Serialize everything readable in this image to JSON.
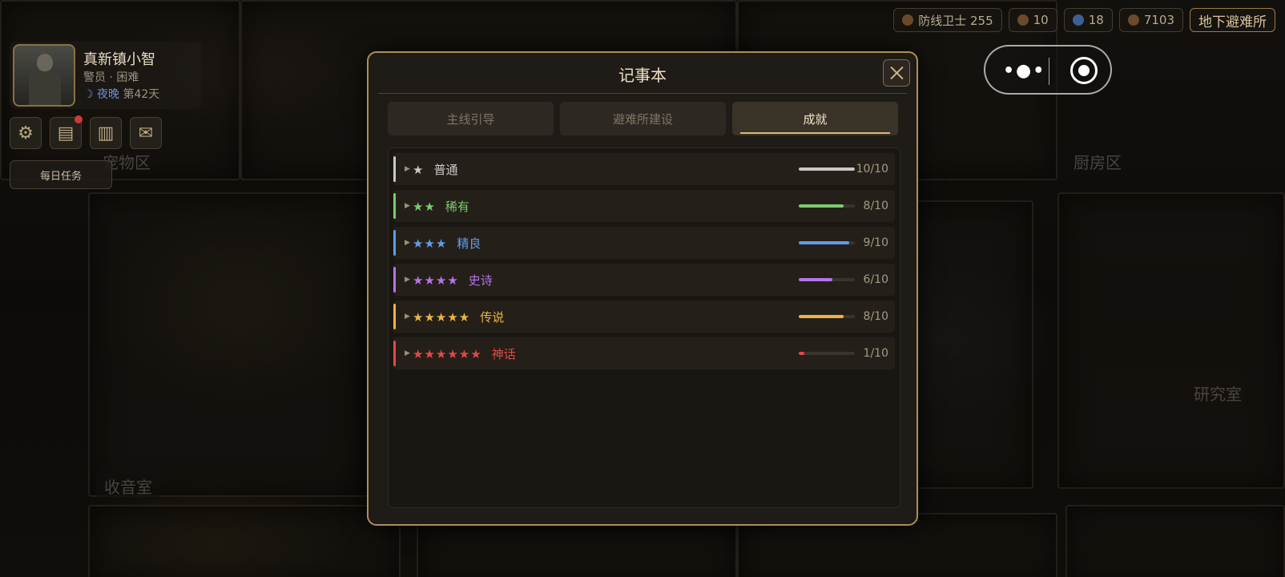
{
  "player": {
    "name": "真新镇小智",
    "rank": "警员 · 困难",
    "time_of_day": "夜晚",
    "day": "第42天"
  },
  "side": {
    "icons": [
      "gear-icon",
      "notebook-icon",
      "book-icon",
      "mail-icon"
    ],
    "daily_task": "每日任务"
  },
  "resources": [
    {
      "label": "防线卫士 255",
      "icon": "shield-icon"
    },
    {
      "label": "10",
      "icon": "coin-icon"
    },
    {
      "label": "18",
      "icon": "gem-icon"
    },
    {
      "label": "7103",
      "icon": "scrap-icon"
    }
  ],
  "location": "地下避难所",
  "rooms": {
    "pet": "宠物区",
    "kitchen": "厨房区",
    "radio": "收音室",
    "research": "研究室"
  },
  "modal": {
    "title": "记事本",
    "tabs": [
      "主线引导",
      "避难所建设",
      "成就"
    ],
    "active_tab": "成就",
    "rows": [
      {
        "stars": "★",
        "name": "普通",
        "progress": 1.0,
        "count": "10/10",
        "color": "#c8c8c8"
      },
      {
        "stars": "★★",
        "name": "稀有",
        "progress": 0.8,
        "count": "8/10",
        "color": "#7ccb6f"
      },
      {
        "stars": "★★★",
        "name": "精良",
        "progress": 0.9,
        "count": "9/10",
        "color": "#5f9de8"
      },
      {
        "stars": "★★★★",
        "name": "史诗",
        "progress": 0.6,
        "count": "6/10",
        "color": "#b574e6"
      },
      {
        "stars": "★★★★★",
        "name": "传说",
        "progress": 0.8,
        "count": "8/10",
        "color": "#f0b341"
      },
      {
        "stars": "★★★★★★",
        "name": "神话",
        "progress": 0.1,
        "count": "1/10",
        "color": "#e5474a"
      }
    ]
  }
}
